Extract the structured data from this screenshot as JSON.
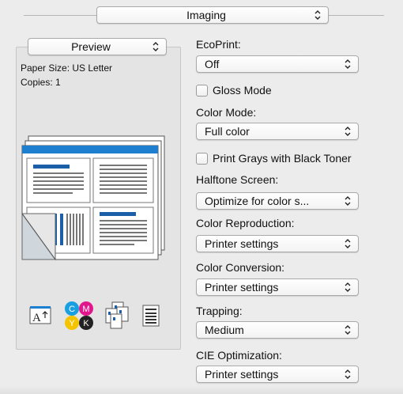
{
  "header": {
    "panel_menu": "Imaging"
  },
  "preview": {
    "menu": "Preview",
    "paper_size": "Paper Size: US Letter",
    "copies": "Copies: 1"
  },
  "settings": {
    "ecoprint": {
      "label": "EcoPrint:",
      "value": "Off"
    },
    "gloss_mode": {
      "label": "Gloss Mode",
      "checked": false
    },
    "color_mode": {
      "label": "Color Mode:",
      "value": "Full color"
    },
    "print_grays": {
      "label": "Print Grays with Black Toner",
      "checked": false
    },
    "halftone": {
      "label": "Halftone Screen:",
      "value": "Optimize for color s..."
    },
    "color_reproduction": {
      "label": "Color Reproduction:",
      "value": "Printer settings"
    },
    "color_conversion": {
      "label": "Color Conversion:",
      "value": "Printer settings"
    },
    "trapping": {
      "label": "Trapping:",
      "value": "Medium"
    },
    "cie_optimization": {
      "label": "CIE Optimization:",
      "value": "Printer settings"
    }
  },
  "icons": {
    "cmyk_letters": [
      "C",
      "M",
      "Y",
      "K"
    ],
    "cmyk_colors": [
      "#1aa0e0",
      "#e2168c",
      "#f5c400",
      "#222222"
    ],
    "text_icon_letter": "A"
  },
  "colors": {
    "accent": "#1e7fd0",
    "accent_dark": "#1b5fa8"
  }
}
